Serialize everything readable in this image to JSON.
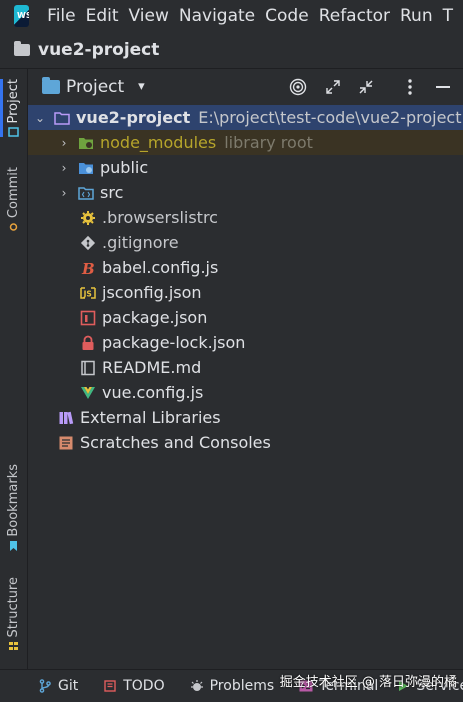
{
  "app": {
    "logo_text": "WS"
  },
  "menu": [
    "File",
    "Edit",
    "View",
    "Navigate",
    "Code",
    "Refactor",
    "Run",
    "T"
  ],
  "window": {
    "project_name": "vue2-project"
  },
  "left_tabs": [
    {
      "label": "Project",
      "icon": "project-icon",
      "active": true
    },
    {
      "label": "Commit",
      "icon": "commit-icon",
      "active": false
    },
    {
      "label": "Bookmarks",
      "icon": "bookmark-icon",
      "active": false
    },
    {
      "label": "Structure",
      "icon": "structure-icon",
      "active": false
    }
  ],
  "panel": {
    "title": "Project",
    "buttons": [
      "target-icon",
      "expand-icon",
      "collapse-icon",
      "more-icon",
      "minimize-icon"
    ]
  },
  "tree": {
    "root": {
      "name": "vue2-project",
      "path": "E:\\project\\test-code\\vue2-project"
    },
    "node_modules": {
      "name": "node_modules",
      "note": "library root"
    },
    "public": {
      "name": "public"
    },
    "src": {
      "name": "src"
    },
    "files": [
      {
        "name": ".browserslistrc",
        "icon": "gear-icon"
      },
      {
        "name": ".gitignore",
        "icon": "git-icon"
      },
      {
        "name": "babel.config.js",
        "icon": "babel-icon"
      },
      {
        "name": "jsconfig.json",
        "icon": "js-icon"
      },
      {
        "name": "package.json",
        "icon": "npm-icon"
      },
      {
        "name": "package-lock.json",
        "icon": "lock-icon"
      },
      {
        "name": "README.md",
        "icon": "markdown-icon"
      },
      {
        "name": "vue.config.js",
        "icon": "vue-icon"
      }
    ],
    "external_libraries": "External Libraries",
    "scratches": "Scratches and Consoles"
  },
  "bottom_tabs": [
    {
      "label": "Git",
      "icon": "git-branch-icon"
    },
    {
      "label": "TODO",
      "icon": "todo-icon"
    },
    {
      "label": "Problems",
      "icon": "problems-icon"
    },
    {
      "label": "Terminal",
      "icon": "terminal-icon"
    },
    {
      "label": "Services",
      "icon": "services-icon"
    }
  ],
  "watermark": "掘金技术社区 @ 落日弥漫的橘",
  "colors": {
    "accent": "#3574f0",
    "selected_row": "#2e436e",
    "library_row": "#3a3323",
    "library_text": "#b6a52b",
    "background": "#2b2d30"
  }
}
